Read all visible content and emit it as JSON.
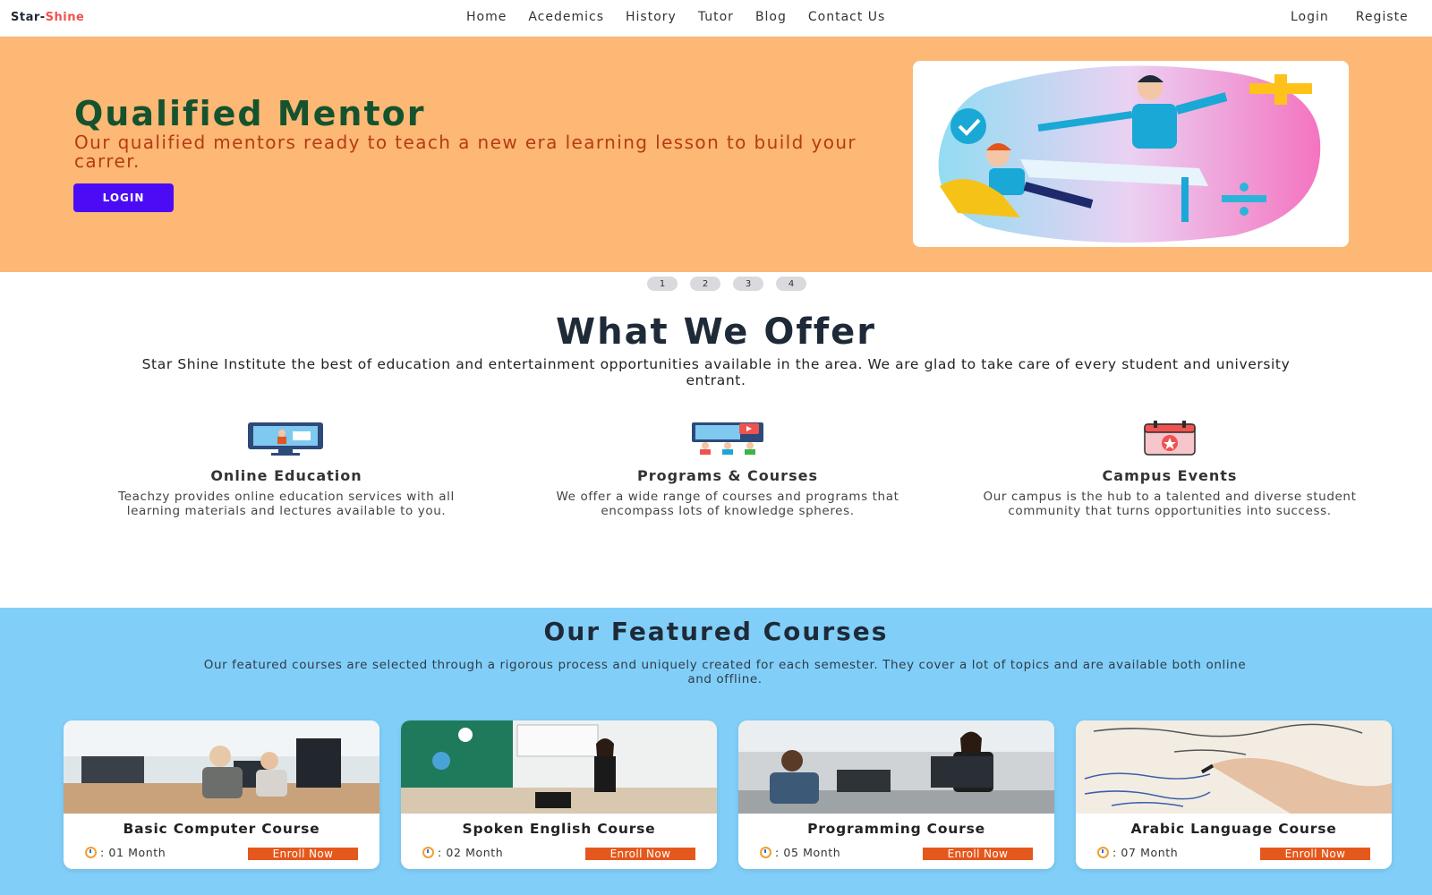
{
  "navbar": {
    "brand_part1": "Star-",
    "brand_part2": "Shine",
    "links": [
      "Home",
      "Acedemics",
      "History",
      "Tutor",
      "Blog",
      "Contact Us"
    ],
    "login": "Login",
    "register": "Registe"
  },
  "hero": {
    "title": "Qualified Mentor",
    "subtitle": "Our qualified mentors ready to teach a new era learning lesson to build your carrer.",
    "button": "LOGIN",
    "slides": [
      "1",
      "2",
      "3",
      "4"
    ]
  },
  "offer": {
    "title": "What We Offer",
    "subtitle": "Star Shine Institute the best of education and entertainment opportunities available in the area. We are glad to take care of every student and university entrant.",
    "features": [
      {
        "title": "Online Education",
        "desc": "Teachzy provides online education services with all learning materials and lectures available to you.",
        "icon": "online-education-icon"
      },
      {
        "title": "Programs & Courses",
        "desc": "We offer a wide range of courses and programs that encompass lots of knowledge spheres.",
        "icon": "programs-courses-icon"
      },
      {
        "title": "Campus Events",
        "desc": "Our campus is the hub to a talented and diverse student community that turns opportunities into success.",
        "icon": "campus-events-icon"
      }
    ]
  },
  "courses": {
    "title": "Our Featured Courses",
    "subtitle": "Our featured courses are selected through a rigorous process and uniquely created for each semester. They cover a lot of topics and are available both online and offline.",
    "items": [
      {
        "title": "Basic Computer Course",
        "duration": ": 01 Month",
        "button": "Enroll Now"
      },
      {
        "title": "Spoken English Course",
        "duration": ": 02 Month",
        "button": "Enroll Now"
      },
      {
        "title": "Programming Course",
        "duration": ": 05 Month",
        "button": "Enroll Now"
      },
      {
        "title": "Arabic Language Course",
        "duration": ": 07 Month",
        "button": "Enroll Now"
      }
    ]
  },
  "colors": {
    "hero_bg": "#fcb874",
    "hero_title": "#15532e",
    "hero_sub": "#b53b14",
    "login_btn": "#4b0cf5",
    "courses_bg": "#81cff9",
    "enroll_btn": "#e5581d",
    "brand_accent": "#ef5350"
  }
}
